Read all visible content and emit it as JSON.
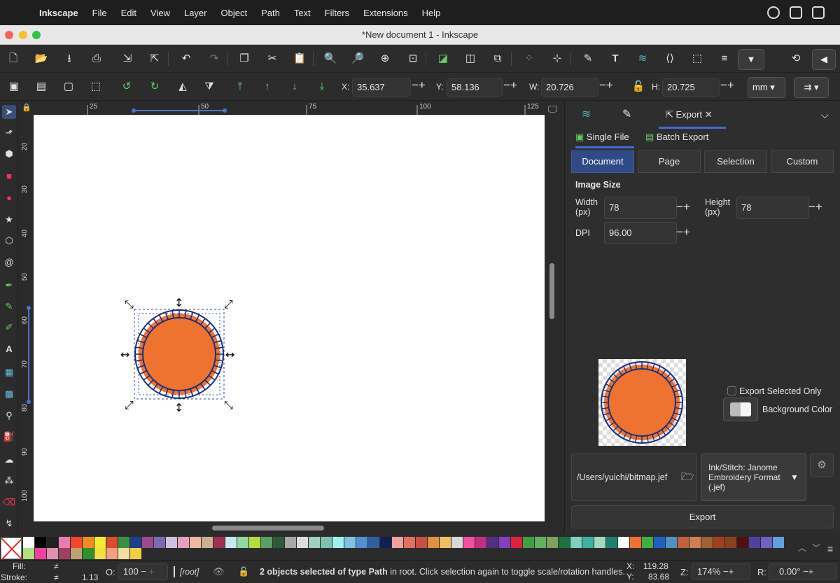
{
  "menubar": {
    "app_name": "Inkscape",
    "items": [
      "File",
      "Edit",
      "View",
      "Layer",
      "Object",
      "Path",
      "Text",
      "Filters",
      "Extensions",
      "Help"
    ]
  },
  "window": {
    "title": "*New document 1 - Inkscape"
  },
  "controls": {
    "x_label": "X:",
    "x_value": "35.637",
    "y_label": "Y:",
    "y_value": "58.136",
    "w_label": "W:",
    "w_value": "20.726",
    "h_label": "H:",
    "h_value": "20.725",
    "unit": "mm"
  },
  "rulers": {
    "h_labels": [
      "25",
      "50",
      "75",
      "100",
      "125"
    ],
    "v_labels": [
      "20",
      "30",
      "40",
      "50",
      "60",
      "70",
      "80",
      "90",
      "100"
    ]
  },
  "dock": {
    "tab_export": "Export",
    "subtabs": {
      "single": "Single File",
      "batch": "Batch Export"
    },
    "segments": [
      "Document",
      "Page",
      "Selection",
      "Custom"
    ],
    "active_segment": "Document",
    "image_size_heading": "Image Size",
    "width_label": "Width",
    "width_unit": "(px)",
    "width_value": "78",
    "height_label": "Height",
    "height_unit": "(px)",
    "height_value": "78",
    "dpi_label": "DPI",
    "dpi_value": "96.00",
    "export_selected_only": "Export Selected Only",
    "background_color": "Background Color",
    "file_path": "/Users/yuichi/bitmap.jef",
    "format": "Ink/Stitch: Janome Embroidery Format (.jef)",
    "export_button": "Export"
  },
  "status": {
    "fill_label": "Fill:",
    "fill_value": "≠",
    "stroke_label": "Stroke:",
    "stroke_value": "≠",
    "stroke_width": "1.13",
    "opacity_label": "O:",
    "opacity_value": "100",
    "layer": "[root]",
    "message_count": "2 objects selected of type",
    "message_type": "Path",
    "message_rest": "in root. Click selection again to toggle scale/rotation handles.",
    "cursor_x_label": "X:",
    "cursor_x": "119.28",
    "cursor_y_label": "Y:",
    "cursor_y": "83.68",
    "zoom_label": "Z:",
    "zoom_value": "174%",
    "rotation_label": "R:",
    "rotation_value": "0.00°"
  },
  "colors": {
    "accent": "#2f4a86",
    "orange_fill": "#ee7330",
    "blue_stroke": "#1e2f7a",
    "palette": [
      "#ffffff",
      "#000000",
      "#222222",
      "#e67eaf",
      "#f2462f",
      "#f58a22",
      "#f4ec2e",
      "#d94f2d",
      "#3d8f46",
      "#1e3d8f",
      "#9b4a8f",
      "#7a6ab0",
      "#d0c0e0",
      "#e6a0c0",
      "#f0b8a0",
      "#c8b090",
      "#a03050",
      "#c8e8f0",
      "#90d8a0",
      "#b4dc3c",
      "#5a9e6a",
      "#2e5a3a",
      "#a8a8a8",
      "#dcdcdc",
      "#a0d0c0",
      "#80c0b0",
      "#a0f0f0",
      "#80c0e0",
      "#5090d0",
      "#3060a0",
      "#102050",
      "#f0a0a0",
      "#e07060",
      "#c85040",
      "#e09040",
      "#f0c060",
      "#d8d8d8",
      "#f050a0",
      "#c03080",
      "#503080",
      "#8040c0",
      "#e02040",
      "#40a040",
      "#60b060",
      "#80a060",
      "#207040",
      "#80d0c0",
      "#40b0a0",
      "#a0d8c0",
      "#208070",
      "#ffffff",
      "#f07030",
      "#40b040",
      "#2060c0",
      "#5090c0",
      "#c06040",
      "#d08050",
      "#a06030",
      "#a04020",
      "#8a4020",
      "#501010",
      "#5040a0",
      "#7060c0",
      "#60a0e0",
      "#b0e080",
      "#f040a0",
      "#e090b0",
      "#a04060",
      "#c0a070",
      "#309030",
      "#f0e040",
      "#f0a080",
      "#f0e0a0",
      "#f0d040"
    ]
  }
}
